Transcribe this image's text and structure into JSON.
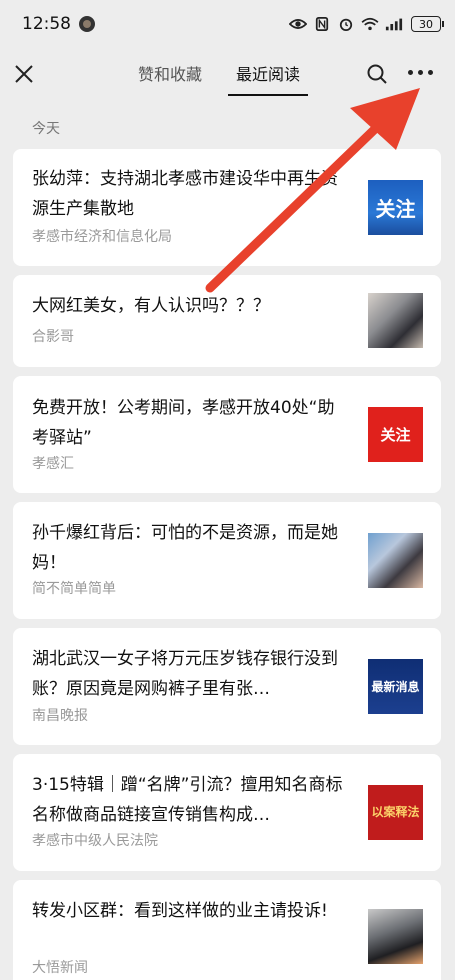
{
  "status_bar": {
    "time": "12:58",
    "battery": "30"
  },
  "header": {
    "tabs": [
      {
        "label": "赞和收藏",
        "active": false
      },
      {
        "label": "最近阅读",
        "active": true
      }
    ]
  },
  "section": {
    "label": "今天"
  },
  "articles": [
    {
      "title": "张幼萍：支持湖北孝感市建设华中再生资源生产集散地",
      "source": "孝感市经济和信息化局",
      "thumb_text": "关注",
      "thumb_style": "blue"
    },
    {
      "title": "大网红美女，有人认识吗？？？",
      "source": "合影哥",
      "thumb_text": "",
      "thumb_style": "photo1"
    },
    {
      "title": "免费开放！公考期间，孝感开放40处“助考驿站”",
      "source": "孝感汇",
      "thumb_text": "关注",
      "thumb_style": "red"
    },
    {
      "title": "孙千爆红背后：可怕的不是资源，而是她妈！",
      "source": "简不简单简单",
      "thumb_text": "",
      "thumb_style": "photo2"
    },
    {
      "title": "湖北武汉一女子将万元压岁钱存银行没到账？原因竟是网购裤子里有张…",
      "source": "南昌晚报",
      "thumb_text": "最新消息",
      "thumb_style": "navy"
    },
    {
      "title": "3·15特辑｜蹭“名牌”引流？擅用知名商标名称做商品链接宣传销售构成…",
      "source": "孝感市中级人民法院",
      "thumb_text": "以案释法",
      "thumb_style": "darkred"
    },
    {
      "title": "转发小区群：看到这样做的业主请投诉!",
      "source": "大悟新闻",
      "thumb_text": "",
      "thumb_style": "photo3"
    }
  ],
  "colors": {
    "background": "#ededed",
    "arrow": "#e8412c",
    "source_text": "#9a9a9a"
  }
}
